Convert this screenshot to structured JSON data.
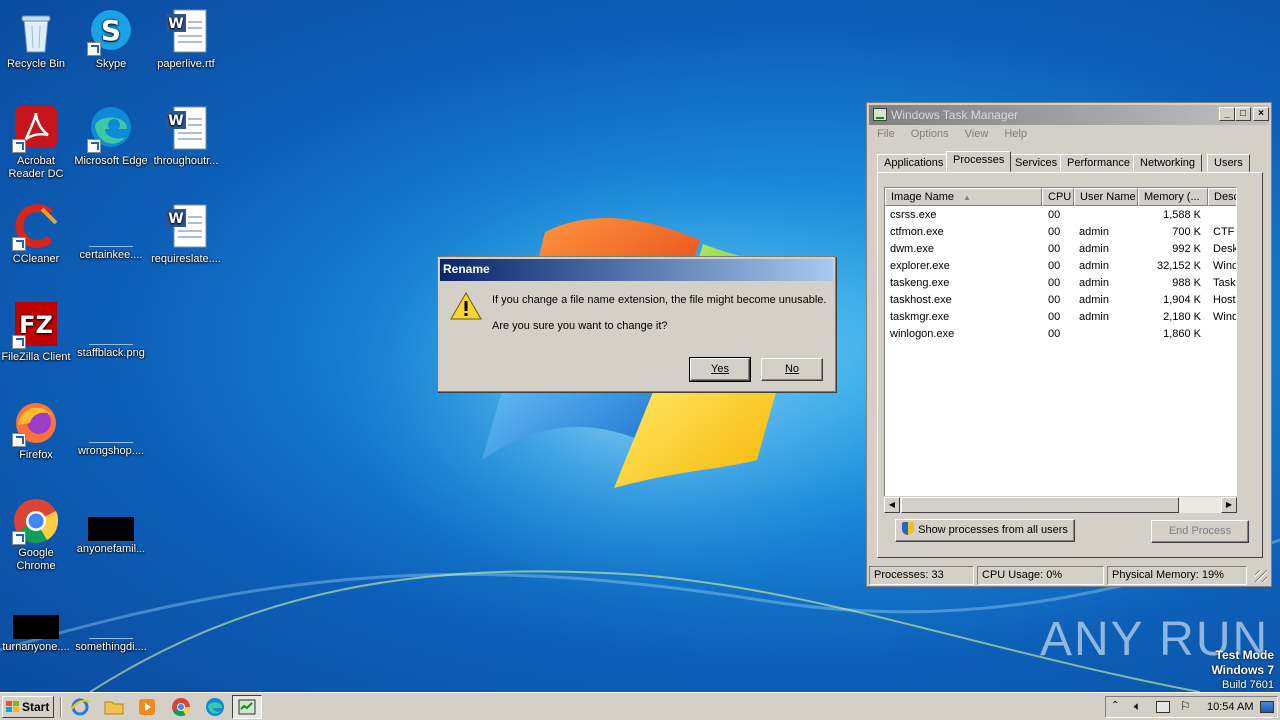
{
  "desktop": {
    "icons": [
      {
        "label": "Recycle Bin",
        "icon": "recycle-bin-icon"
      },
      {
        "label": "Skype",
        "icon": "skype-icon"
      },
      {
        "label": "paperlive.rtf",
        "icon": "word-document-icon"
      },
      {
        "label": "Acrobat Reader DC",
        "icon": "acrobat-icon"
      },
      {
        "label": "Microsoft Edge",
        "icon": "edge-icon"
      },
      {
        "label": "throughoutr...",
        "icon": "word-document-icon"
      },
      {
        "label": "CCleaner",
        "icon": "ccleaner-icon"
      },
      {
        "label": "certainkee....",
        "icon": "blank-file-icon"
      },
      {
        "label": "requireslate....",
        "icon": "word-document-icon"
      },
      {
        "label": "FileZilla Client",
        "icon": "filezilla-icon"
      },
      {
        "label": "staffblack.png",
        "icon": "blank-file-icon"
      },
      {
        "label": "Firefox",
        "icon": "firefox-icon"
      },
      {
        "label": "wrongshop....",
        "icon": "blank-file-icon"
      },
      {
        "label": "Google Chrome",
        "icon": "chrome-icon"
      },
      {
        "label": "anyonefamil...",
        "icon": "black-thumbnail-icon"
      },
      {
        "label": "turnanyone....",
        "icon": "black-thumbnail-icon"
      },
      {
        "label": "somethingdi....",
        "icon": "blank-file-icon"
      }
    ]
  },
  "rename_dialog": {
    "title": "Rename",
    "message_line1": "If you change a file name extension, the file might become unusable.",
    "message_line2": "Are you sure you want to change it?",
    "yes_label": "Yes",
    "no_label": "No"
  },
  "task_manager": {
    "title": "Windows Task Manager",
    "menu": [
      "File",
      "Options",
      "View",
      "Help"
    ],
    "tabs": [
      "Applications",
      "Processes",
      "Services",
      "Performance",
      "Networking",
      "Users"
    ],
    "active_tab": "Processes",
    "columns": [
      "Image Name",
      "CPU",
      "User Name",
      "Memory (...",
      "Desc"
    ],
    "rows": [
      {
        "name": "csrss.exe",
        "cpu": "00",
        "user": "",
        "mem": "1,588 K",
        "desc": ""
      },
      {
        "name": "ctfmon.exe",
        "cpu": "00",
        "user": "admin",
        "mem": "700 K",
        "desc": "CTF I"
      },
      {
        "name": "dwm.exe",
        "cpu": "00",
        "user": "admin",
        "mem": "992 K",
        "desc": "Desk"
      },
      {
        "name": "explorer.exe",
        "cpu": "00",
        "user": "admin",
        "mem": "32,152 K",
        "desc": "Wind"
      },
      {
        "name": "taskeng.exe",
        "cpu": "00",
        "user": "admin",
        "mem": "988 K",
        "desc": "Task"
      },
      {
        "name": "taskhost.exe",
        "cpu": "00",
        "user": "admin",
        "mem": "1,904 K",
        "desc": "Host"
      },
      {
        "name": "taskmgr.exe",
        "cpu": "00",
        "user": "admin",
        "mem": "2,180 K",
        "desc": "Wind"
      },
      {
        "name": "winlogon.exe",
        "cpu": "00",
        "user": "",
        "mem": "1,860 K",
        "desc": ""
      }
    ],
    "show_all_label": "Show processes from all users",
    "end_process_label": "End Process",
    "status": {
      "processes": "Processes: 33",
      "cpu": "CPU Usage: 0%",
      "memory": "Physical Memory: 19%"
    }
  },
  "watermark": {
    "brand": "ANY RUN",
    "test_mode": "Test Mode",
    "os": "Windows 7",
    "build": "Build 7601"
  },
  "taskbar": {
    "start_label": "Start",
    "clock": "10:54 AM",
    "pinned": [
      "internet-explorer-icon",
      "explorer-folder-icon",
      "media-player-icon",
      "chrome-icon",
      "edge-icon",
      "task-manager-icon"
    ]
  }
}
